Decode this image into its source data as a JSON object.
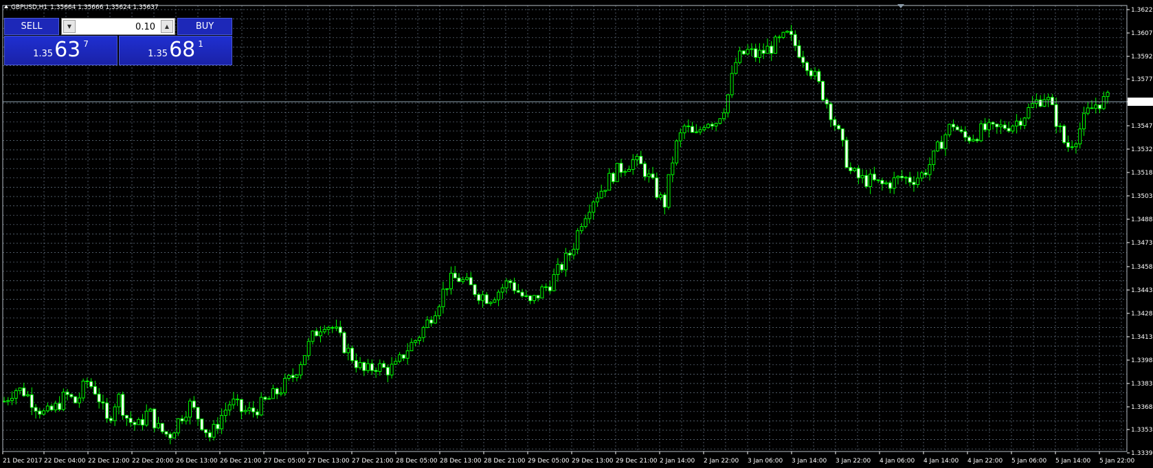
{
  "header": {
    "symbol": "GBPUSD,H1",
    "ohlc": "1.35664 1.35666 1.35624 1.35637"
  },
  "trade": {
    "sell_label": "SELL",
    "buy_label": "BUY",
    "lot": "0.10",
    "sell_price": {
      "prefix": "1.35",
      "big": "63",
      "sup": "7"
    },
    "buy_price": {
      "prefix": "1.35",
      "big": "68",
      "sup": "1"
    }
  },
  "icons": {
    "collapse": "triangle-up-icon",
    "lot_down": "arrow-down-icon",
    "lot_up": "arrow-up-icon",
    "shift_marker": "triangle-down-icon"
  },
  "colors": {
    "background": "#000000",
    "grid": "#6b7a8c",
    "candle": "#00ff00",
    "bid_line": "#8fa3b0"
  },
  "chart_data": {
    "type": "candlestick",
    "title": "",
    "y_ticks": [
      "1.36225",
      "1.36075",
      "1.35925",
      "1.35775",
      "1.35637",
      "1.35475",
      "1.35325",
      "1.35180",
      "1.35030",
      "1.34880",
      "1.34730",
      "1.34580",
      "1.34430",
      "1.34280",
      "1.34130",
      "1.33980",
      "1.33830",
      "1.33680",
      "1.33535",
      "1.33390"
    ],
    "current_price": "1.35637",
    "x_ticks": [
      "21 Dec 2017",
      "22 Dec 04:00",
      "22 Dec 12:00",
      "22 Dec 20:00",
      "26 Dec 13:00",
      "26 Dec 21:00",
      "27 Dec 05:00",
      "27 Dec 13:00",
      "27 Dec 21:00",
      "28 Dec 05:00",
      "28 Dec 13:00",
      "28 Dec 21:00",
      "29 Dec 05:00",
      "29 Dec 13:00",
      "29 Dec 21:00",
      "2 Jan 14:00",
      "2 Jan 22:00",
      "3 Jan 06:00",
      "3 Jan 14:00",
      "3 Jan 22:00",
      "4 Jan 06:00",
      "4 Jan 14:00",
      "4 Jan 22:00",
      "5 Jan 06:00",
      "5 Jan 14:00",
      "5 Jan 22:00"
    ],
    "close_path": [
      1.3372,
      1.338,
      1.3378,
      1.337,
      1.3363,
      1.3368,
      1.3376,
      1.3371,
      1.3385,
      1.3378,
      1.3358,
      1.3376,
      1.336,
      1.3356,
      1.3366,
      1.3354,
      1.335,
      1.3361,
      1.337,
      1.336,
      1.3349,
      1.3362,
      1.3372,
      1.3366,
      1.3365,
      1.337,
      1.3375,
      1.3381,
      1.3388,
      1.3401,
      1.3414,
      1.3423,
      1.3418,
      1.3407,
      1.3398,
      1.339,
      1.3395,
      1.3392,
      1.3394,
      1.3405,
      1.3412,
      1.3422,
      1.3434,
      1.3448,
      1.3451,
      1.3446,
      1.3441,
      1.3438,
      1.3443,
      1.3449,
      1.3441,
      1.3434,
      1.3442,
      1.3448,
      1.3458,
      1.3468,
      1.3488,
      1.3501,
      1.3508,
      1.3517,
      1.3522,
      1.3526,
      1.3521,
      1.3509,
      1.3497,
      1.3533,
      1.3548,
      1.354,
      1.3552,
      1.3551,
      1.3563,
      1.359,
      1.3596,
      1.3593,
      1.3597,
      1.3601,
      1.3606,
      1.3597,
      1.3587,
      1.3574,
      1.356,
      1.3541,
      1.3519,
      1.3514,
      1.3513,
      1.351,
      1.3512,
      1.3515,
      1.3514,
      1.3517,
      1.3526,
      1.354,
      1.355,
      1.354,
      1.3542,
      1.3546,
      1.3545,
      1.3548,
      1.355,
      1.3556,
      1.3563,
      1.3568,
      1.3552,
      1.3534,
      1.3542,
      1.3556,
      1.3563,
      1.3565
    ]
  }
}
